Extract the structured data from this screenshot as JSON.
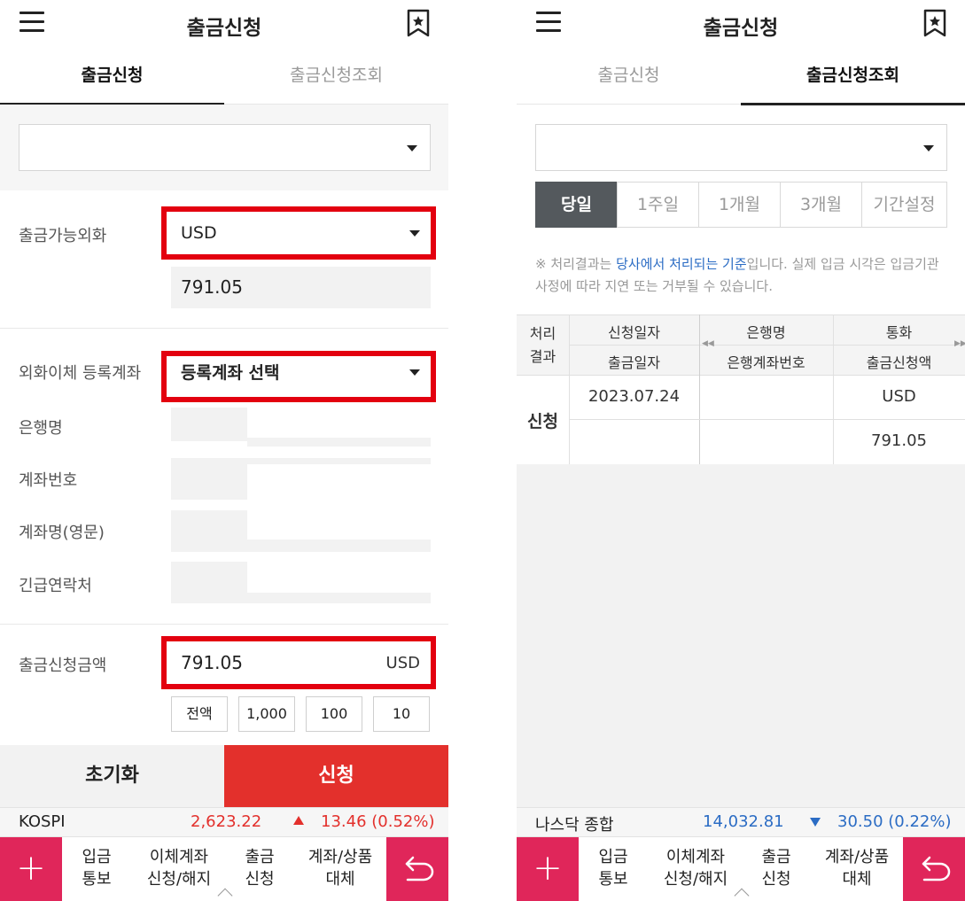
{
  "left": {
    "header": {
      "title": "출금신청",
      "menu_icon": "hamburger-icon",
      "bookmark_icon": "bookmark-star-icon"
    },
    "tabs": [
      {
        "label": "출금신청",
        "active": true
      },
      {
        "label": "출금신청조회",
        "active": false
      }
    ],
    "account_select": {
      "value": ""
    },
    "fields": {
      "available_currency": {
        "label": "출금가능외화",
        "value": "USD"
      },
      "available_amount": {
        "value": "791.05"
      },
      "registered_account": {
        "label": "외화이체 등록계좌",
        "value": "등록계좌 선택"
      },
      "bank_name": {
        "label": "은행명"
      },
      "account_number": {
        "label": "계좌번호"
      },
      "account_name": {
        "label": "계좌명(영문)"
      },
      "emergency_contact": {
        "label": "긴급연락처"
      },
      "request_amount": {
        "label": "출금신청금액",
        "value": "791.05",
        "unit": "USD"
      }
    },
    "quick_buttons": [
      "전액",
      "1,000",
      "100",
      "10"
    ],
    "actions": {
      "reset": "초기화",
      "submit": "신청"
    },
    "ticker": {
      "name": "KOSPI",
      "value": "2,623.22",
      "change": "13.46 (0.52%)",
      "direction": "up",
      "color": "#e3302c"
    }
  },
  "right": {
    "header": {
      "title": "출금신청",
      "menu_icon": "hamburger-icon",
      "bookmark_icon": "bookmark-star-icon"
    },
    "tabs": [
      {
        "label": "출금신청",
        "active": false
      },
      {
        "label": "출금신청조회",
        "active": true
      }
    ],
    "account_select": {
      "value": ""
    },
    "periods": [
      {
        "label": "당일",
        "active": true
      },
      {
        "label": "1주일"
      },
      {
        "label": "1개월"
      },
      {
        "label": "3개월"
      },
      {
        "label": "기간설정"
      }
    ],
    "notice": {
      "prefix": "※ 처리결과는 ",
      "highlight": "당사에서 처리되는 기준",
      "suffix": "입니다. 실제 입금 시각은 입금기관 사정에 따라 지연 또는 거부될 수 있습니다."
    },
    "table": {
      "headers": {
        "status_line1": "처리",
        "status_line2": "결과",
        "request_date": "신청일자",
        "withdraw_date": "출금일자",
        "bank_name": "은행명",
        "bank_account": "은행계좌번호",
        "currency": "통화",
        "amount": "출금신청액"
      },
      "rows": [
        {
          "status": "신청",
          "request_date": "2023.07.24",
          "withdraw_date": "",
          "bank_name": "",
          "bank_account": "",
          "currency": "USD",
          "amount": "791.05"
        }
      ]
    },
    "ticker": {
      "name": "나스닥 종합",
      "value": "14,032.81",
      "change": "30.50 (0.22%)",
      "direction": "down",
      "color": "#2b6cc4"
    }
  },
  "bottom_nav": {
    "plus_icon": "plus-icon",
    "back_icon": "return-arrow-icon",
    "items": [
      "입금\n통보",
      "이체계좌\n신청/해지",
      "출금\n신청",
      "계좌/상품\n대체"
    ]
  },
  "colors": {
    "accent_red": "#e3302c",
    "highlight_box": "#e3000f",
    "nav_pink": "#e0265a",
    "active_period": "#54595d",
    "link_blue": "#2b6cc4"
  }
}
